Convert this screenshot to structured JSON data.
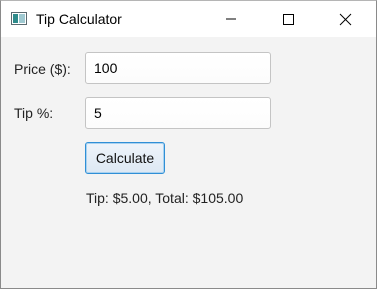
{
  "window": {
    "title": "Tip Calculator"
  },
  "form": {
    "price_label": "Price ($):",
    "price_value": "100",
    "tip_label": "Tip %:",
    "tip_value": "5",
    "calculate_label": "Calculate",
    "result_text": "Tip: $5.00, Total: $105.00"
  },
  "icons": {
    "app": "java-app-icon",
    "minimize": "minimize-icon",
    "maximize": "maximize-icon",
    "close": "close-icon"
  },
  "colors": {
    "accent": "#2f8fd6",
    "window_bg": "#f3f3f3",
    "titlebar_bg": "#ffffff"
  }
}
